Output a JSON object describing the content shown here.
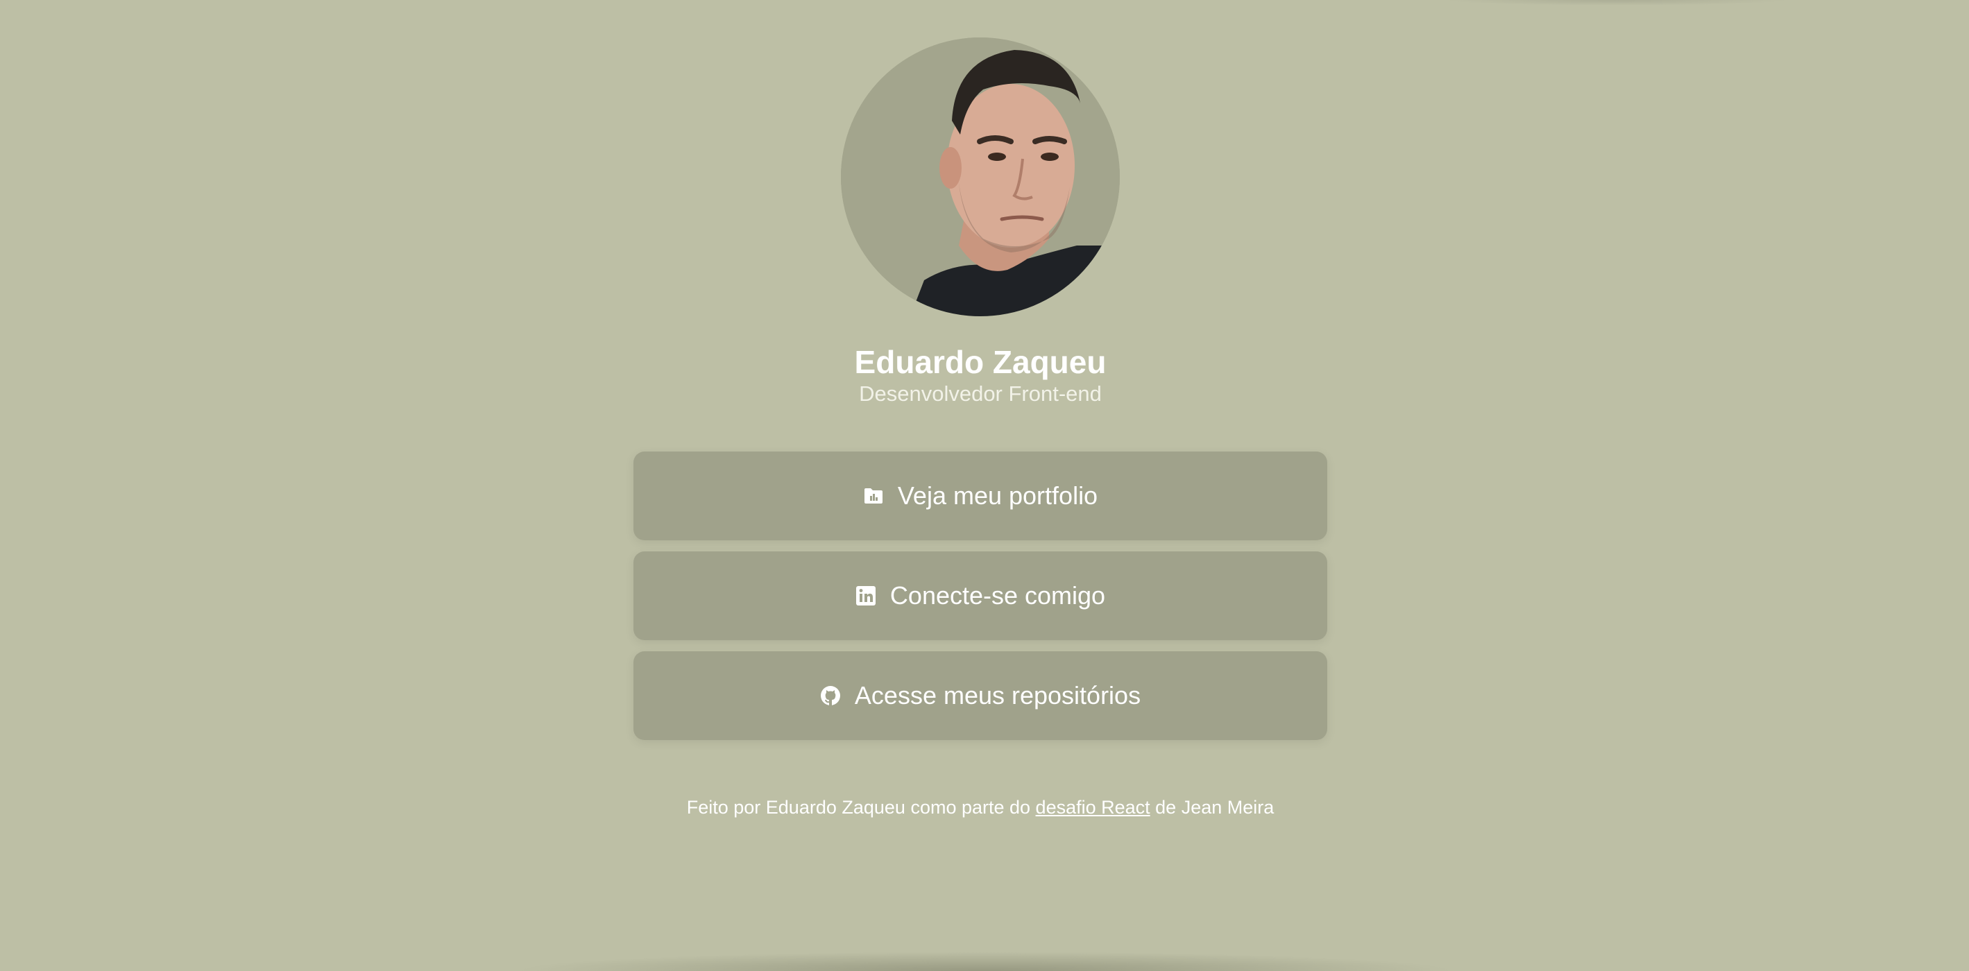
{
  "profile": {
    "avatar_alt": "Eduardo Zaqueu",
    "name": "Eduardo Zaqueu",
    "role": "Desenvolvedor Front-end"
  },
  "links": [
    {
      "label": "Veja meu portfolio",
      "icon": "folder-chart-icon"
    },
    {
      "label": "Conecte-se comigo",
      "icon": "linkedin-icon"
    },
    {
      "label": "Acesse meus repositórios",
      "icon": "github-icon"
    }
  ],
  "footer": {
    "prefix": "Feito por Eduardo Zaqueu como parte do ",
    "link_text": "desafio React",
    "suffix": " de Jean Meira"
  },
  "colors": {
    "background": "#bdbfa5",
    "button": "#a0a28b",
    "text": "#ffffff"
  }
}
